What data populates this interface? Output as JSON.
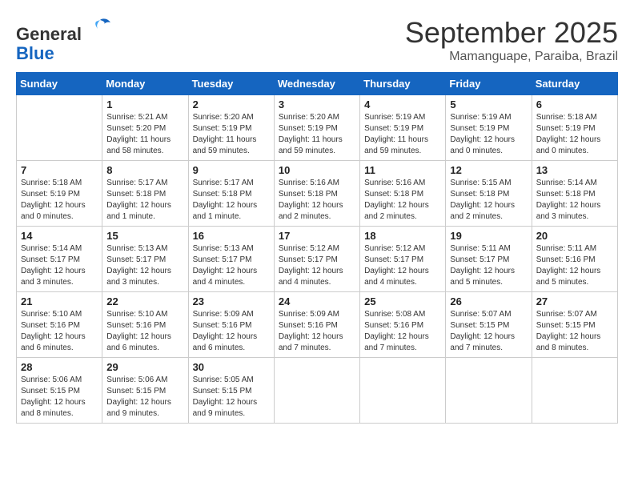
{
  "header": {
    "logo_general": "General",
    "logo_blue": "Blue",
    "month_title": "September 2025",
    "subtitle": "Mamanguape, Paraiba, Brazil"
  },
  "days_of_week": [
    "Sunday",
    "Monday",
    "Tuesday",
    "Wednesday",
    "Thursday",
    "Friday",
    "Saturday"
  ],
  "weeks": [
    [
      {
        "day": "",
        "info": ""
      },
      {
        "day": "1",
        "info": "Sunrise: 5:21 AM\nSunset: 5:20 PM\nDaylight: 11 hours\nand 58 minutes."
      },
      {
        "day": "2",
        "info": "Sunrise: 5:20 AM\nSunset: 5:19 PM\nDaylight: 11 hours\nand 59 minutes."
      },
      {
        "day": "3",
        "info": "Sunrise: 5:20 AM\nSunset: 5:19 PM\nDaylight: 11 hours\nand 59 minutes."
      },
      {
        "day": "4",
        "info": "Sunrise: 5:19 AM\nSunset: 5:19 PM\nDaylight: 11 hours\nand 59 minutes."
      },
      {
        "day": "5",
        "info": "Sunrise: 5:19 AM\nSunset: 5:19 PM\nDaylight: 12 hours\nand 0 minutes."
      },
      {
        "day": "6",
        "info": "Sunrise: 5:18 AM\nSunset: 5:19 PM\nDaylight: 12 hours\nand 0 minutes."
      }
    ],
    [
      {
        "day": "7",
        "info": "Sunrise: 5:18 AM\nSunset: 5:19 PM\nDaylight: 12 hours\nand 0 minutes."
      },
      {
        "day": "8",
        "info": "Sunrise: 5:17 AM\nSunset: 5:18 PM\nDaylight: 12 hours\nand 1 minute."
      },
      {
        "day": "9",
        "info": "Sunrise: 5:17 AM\nSunset: 5:18 PM\nDaylight: 12 hours\nand 1 minute."
      },
      {
        "day": "10",
        "info": "Sunrise: 5:16 AM\nSunset: 5:18 PM\nDaylight: 12 hours\nand 2 minutes."
      },
      {
        "day": "11",
        "info": "Sunrise: 5:16 AM\nSunset: 5:18 PM\nDaylight: 12 hours\nand 2 minutes."
      },
      {
        "day": "12",
        "info": "Sunrise: 5:15 AM\nSunset: 5:18 PM\nDaylight: 12 hours\nand 2 minutes."
      },
      {
        "day": "13",
        "info": "Sunrise: 5:14 AM\nSunset: 5:18 PM\nDaylight: 12 hours\nand 3 minutes."
      }
    ],
    [
      {
        "day": "14",
        "info": "Sunrise: 5:14 AM\nSunset: 5:17 PM\nDaylight: 12 hours\nand 3 minutes."
      },
      {
        "day": "15",
        "info": "Sunrise: 5:13 AM\nSunset: 5:17 PM\nDaylight: 12 hours\nand 3 minutes."
      },
      {
        "day": "16",
        "info": "Sunrise: 5:13 AM\nSunset: 5:17 PM\nDaylight: 12 hours\nand 4 minutes."
      },
      {
        "day": "17",
        "info": "Sunrise: 5:12 AM\nSunset: 5:17 PM\nDaylight: 12 hours\nand 4 minutes."
      },
      {
        "day": "18",
        "info": "Sunrise: 5:12 AM\nSunset: 5:17 PM\nDaylight: 12 hours\nand 4 minutes."
      },
      {
        "day": "19",
        "info": "Sunrise: 5:11 AM\nSunset: 5:17 PM\nDaylight: 12 hours\nand 5 minutes."
      },
      {
        "day": "20",
        "info": "Sunrise: 5:11 AM\nSunset: 5:16 PM\nDaylight: 12 hours\nand 5 minutes."
      }
    ],
    [
      {
        "day": "21",
        "info": "Sunrise: 5:10 AM\nSunset: 5:16 PM\nDaylight: 12 hours\nand 6 minutes."
      },
      {
        "day": "22",
        "info": "Sunrise: 5:10 AM\nSunset: 5:16 PM\nDaylight: 12 hours\nand 6 minutes."
      },
      {
        "day": "23",
        "info": "Sunrise: 5:09 AM\nSunset: 5:16 PM\nDaylight: 12 hours\nand 6 minutes."
      },
      {
        "day": "24",
        "info": "Sunrise: 5:09 AM\nSunset: 5:16 PM\nDaylight: 12 hours\nand 7 minutes."
      },
      {
        "day": "25",
        "info": "Sunrise: 5:08 AM\nSunset: 5:16 PM\nDaylight: 12 hours\nand 7 minutes."
      },
      {
        "day": "26",
        "info": "Sunrise: 5:07 AM\nSunset: 5:15 PM\nDaylight: 12 hours\nand 7 minutes."
      },
      {
        "day": "27",
        "info": "Sunrise: 5:07 AM\nSunset: 5:15 PM\nDaylight: 12 hours\nand 8 minutes."
      }
    ],
    [
      {
        "day": "28",
        "info": "Sunrise: 5:06 AM\nSunset: 5:15 PM\nDaylight: 12 hours\nand 8 minutes."
      },
      {
        "day": "29",
        "info": "Sunrise: 5:06 AM\nSunset: 5:15 PM\nDaylight: 12 hours\nand 9 minutes."
      },
      {
        "day": "30",
        "info": "Sunrise: 5:05 AM\nSunset: 5:15 PM\nDaylight: 12 hours\nand 9 minutes."
      },
      {
        "day": "",
        "info": ""
      },
      {
        "day": "",
        "info": ""
      },
      {
        "day": "",
        "info": ""
      },
      {
        "day": "",
        "info": ""
      }
    ]
  ]
}
